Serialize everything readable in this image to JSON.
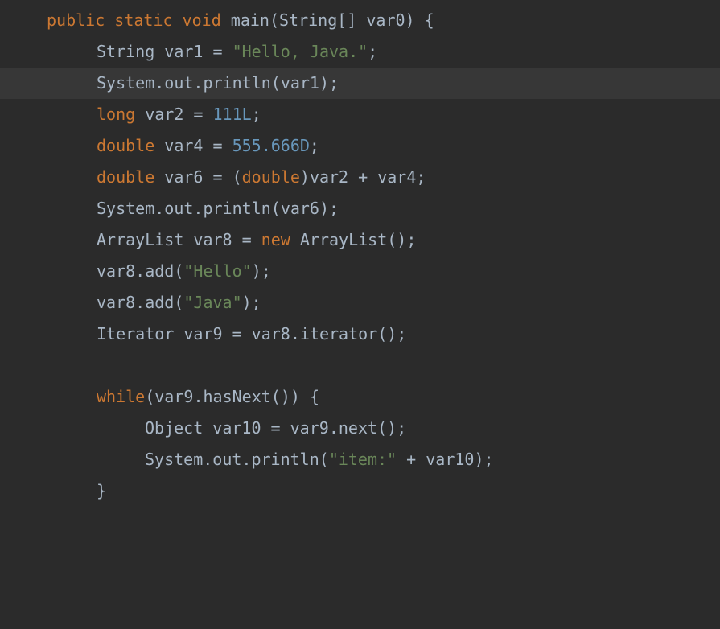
{
  "code": {
    "lines": [
      {
        "indent": 0,
        "highlighted": false,
        "tokens": [
          {
            "text": "public static void ",
            "class": "keyword"
          },
          {
            "text": "main",
            "class": "method"
          },
          {
            "text": "(",
            "class": "paren"
          },
          {
            "text": "String",
            "class": "type"
          },
          {
            "text": "[] ",
            "class": "punct"
          },
          {
            "text": "var0",
            "class": "identifier"
          },
          {
            "text": ") {",
            "class": "paren"
          }
        ]
      },
      {
        "indent": 1,
        "highlighted": false,
        "tokens": [
          {
            "text": "String ",
            "class": "type"
          },
          {
            "text": "var1",
            "class": "identifier"
          },
          {
            "text": " = ",
            "class": "operator"
          },
          {
            "text": "\"Hello, Java.\"",
            "class": "string"
          },
          {
            "text": ";",
            "class": "punct"
          }
        ]
      },
      {
        "indent": 1,
        "highlighted": true,
        "tokens": [
          {
            "text": "System",
            "class": "type"
          },
          {
            "text": ".",
            "class": "punct"
          },
          {
            "text": "out",
            "class": "identifier"
          },
          {
            "text": ".",
            "class": "punct"
          },
          {
            "text": "println",
            "class": "method"
          },
          {
            "text": "(",
            "class": "paren"
          },
          {
            "text": "var1",
            "class": "identifier"
          },
          {
            "text": ");",
            "class": "paren"
          }
        ]
      },
      {
        "indent": 1,
        "highlighted": false,
        "tokens": [
          {
            "text": "long ",
            "class": "keyword"
          },
          {
            "text": "var2",
            "class": "identifier"
          },
          {
            "text": " = ",
            "class": "operator"
          },
          {
            "text": "111L",
            "class": "number"
          },
          {
            "text": ";",
            "class": "punct"
          }
        ]
      },
      {
        "indent": 1,
        "highlighted": false,
        "tokens": [
          {
            "text": "double ",
            "class": "keyword"
          },
          {
            "text": "var4",
            "class": "identifier"
          },
          {
            "text": " = ",
            "class": "operator"
          },
          {
            "text": "555.666D",
            "class": "number"
          },
          {
            "text": ";",
            "class": "punct"
          }
        ]
      },
      {
        "indent": 1,
        "highlighted": false,
        "tokens": [
          {
            "text": "double ",
            "class": "keyword"
          },
          {
            "text": "var6",
            "class": "identifier"
          },
          {
            "text": " = (",
            "class": "operator"
          },
          {
            "text": "double",
            "class": "keyword"
          },
          {
            "text": ")",
            "class": "paren"
          },
          {
            "text": "var2",
            "class": "identifier"
          },
          {
            "text": " + ",
            "class": "operator"
          },
          {
            "text": "var4",
            "class": "identifier"
          },
          {
            "text": ";",
            "class": "punct"
          }
        ]
      },
      {
        "indent": 1,
        "highlighted": false,
        "tokens": [
          {
            "text": "System",
            "class": "type"
          },
          {
            "text": ".",
            "class": "punct"
          },
          {
            "text": "out",
            "class": "identifier"
          },
          {
            "text": ".",
            "class": "punct"
          },
          {
            "text": "println",
            "class": "method"
          },
          {
            "text": "(",
            "class": "paren"
          },
          {
            "text": "var6",
            "class": "identifier"
          },
          {
            "text": ");",
            "class": "paren"
          }
        ]
      },
      {
        "indent": 1,
        "highlighted": false,
        "tokens": [
          {
            "text": "ArrayList ",
            "class": "type"
          },
          {
            "text": "var8",
            "class": "identifier"
          },
          {
            "text": " = ",
            "class": "operator"
          },
          {
            "text": "new ",
            "class": "keyword"
          },
          {
            "text": "ArrayList",
            "class": "type"
          },
          {
            "text": "();",
            "class": "paren"
          }
        ]
      },
      {
        "indent": 1,
        "highlighted": false,
        "tokens": [
          {
            "text": "var8",
            "class": "identifier"
          },
          {
            "text": ".",
            "class": "punct"
          },
          {
            "text": "add",
            "class": "method"
          },
          {
            "text": "(",
            "class": "paren"
          },
          {
            "text": "\"Hello\"",
            "class": "string"
          },
          {
            "text": ");",
            "class": "paren"
          }
        ]
      },
      {
        "indent": 1,
        "highlighted": false,
        "tokens": [
          {
            "text": "var8",
            "class": "identifier"
          },
          {
            "text": ".",
            "class": "punct"
          },
          {
            "text": "add",
            "class": "method"
          },
          {
            "text": "(",
            "class": "paren"
          },
          {
            "text": "\"Java\"",
            "class": "string"
          },
          {
            "text": ");",
            "class": "paren"
          }
        ]
      },
      {
        "indent": 1,
        "highlighted": false,
        "tokens": [
          {
            "text": "Iterator ",
            "class": "type"
          },
          {
            "text": "var9",
            "class": "identifier"
          },
          {
            "text": " = ",
            "class": "operator"
          },
          {
            "text": "var8",
            "class": "identifier"
          },
          {
            "text": ".",
            "class": "punct"
          },
          {
            "text": "iterator",
            "class": "method"
          },
          {
            "text": "();",
            "class": "paren"
          }
        ]
      },
      {
        "indent": 1,
        "highlighted": false,
        "tokens": []
      },
      {
        "indent": 1,
        "highlighted": false,
        "tokens": [
          {
            "text": "while",
            "class": "keyword"
          },
          {
            "text": "(",
            "class": "paren"
          },
          {
            "text": "var9",
            "class": "identifier"
          },
          {
            "text": ".",
            "class": "punct"
          },
          {
            "text": "hasNext",
            "class": "method"
          },
          {
            "text": "()) {",
            "class": "paren"
          }
        ]
      },
      {
        "indent": 2,
        "highlighted": false,
        "tokens": [
          {
            "text": "Object ",
            "class": "type"
          },
          {
            "text": "var10",
            "class": "identifier"
          },
          {
            "text": " = ",
            "class": "operator"
          },
          {
            "text": "var9",
            "class": "identifier"
          },
          {
            "text": ".",
            "class": "punct"
          },
          {
            "text": "next",
            "class": "method"
          },
          {
            "text": "();",
            "class": "paren"
          }
        ]
      },
      {
        "indent": 2,
        "highlighted": false,
        "tokens": [
          {
            "text": "System",
            "class": "type"
          },
          {
            "text": ".",
            "class": "punct"
          },
          {
            "text": "out",
            "class": "identifier"
          },
          {
            "text": ".",
            "class": "punct"
          },
          {
            "text": "println",
            "class": "method"
          },
          {
            "text": "(",
            "class": "paren"
          },
          {
            "text": "\"item:\"",
            "class": "string"
          },
          {
            "text": " + ",
            "class": "operator"
          },
          {
            "text": "var10",
            "class": "identifier"
          },
          {
            "text": ");",
            "class": "paren"
          }
        ]
      },
      {
        "indent": 1,
        "highlighted": false,
        "tokens": [
          {
            "text": "}",
            "class": "paren"
          }
        ]
      }
    ]
  }
}
